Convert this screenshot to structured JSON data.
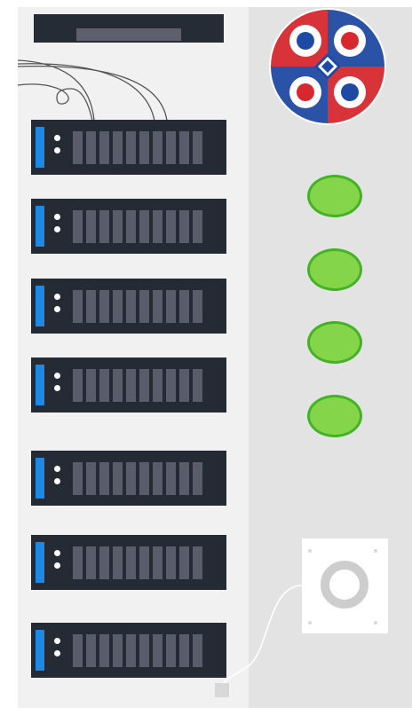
{
  "illustration": {
    "subject": "server-rack",
    "logo": {
      "icon": "logo-icon",
      "colors": [
        "#d7282f",
        "#1f4aa3"
      ]
    },
    "rack_units": [
      {
        "name": "server-unit-1",
        "drive_bays": 10
      },
      {
        "name": "server-unit-2",
        "drive_bays": 10
      },
      {
        "name": "server-unit-3",
        "drive_bays": 10
      },
      {
        "name": "server-unit-4",
        "drive_bays": 10
      },
      {
        "name": "server-unit-5",
        "drive_bays": 10
      },
      {
        "name": "server-unit-6",
        "drive_bays": 10
      },
      {
        "name": "server-unit-7",
        "drive_bays": 10
      }
    ],
    "status_lights": {
      "count": 4,
      "color": "#85d54a",
      "outline": "#43b225"
    },
    "speaker": {
      "icon": "speaker-icon"
    },
    "colors": {
      "rack_body": "#f1f1f1",
      "side_panel": "#e3e3e3",
      "server_face": "#252b34",
      "drive_bay": "#595c6b",
      "activity_led": "#1e88e5"
    }
  }
}
